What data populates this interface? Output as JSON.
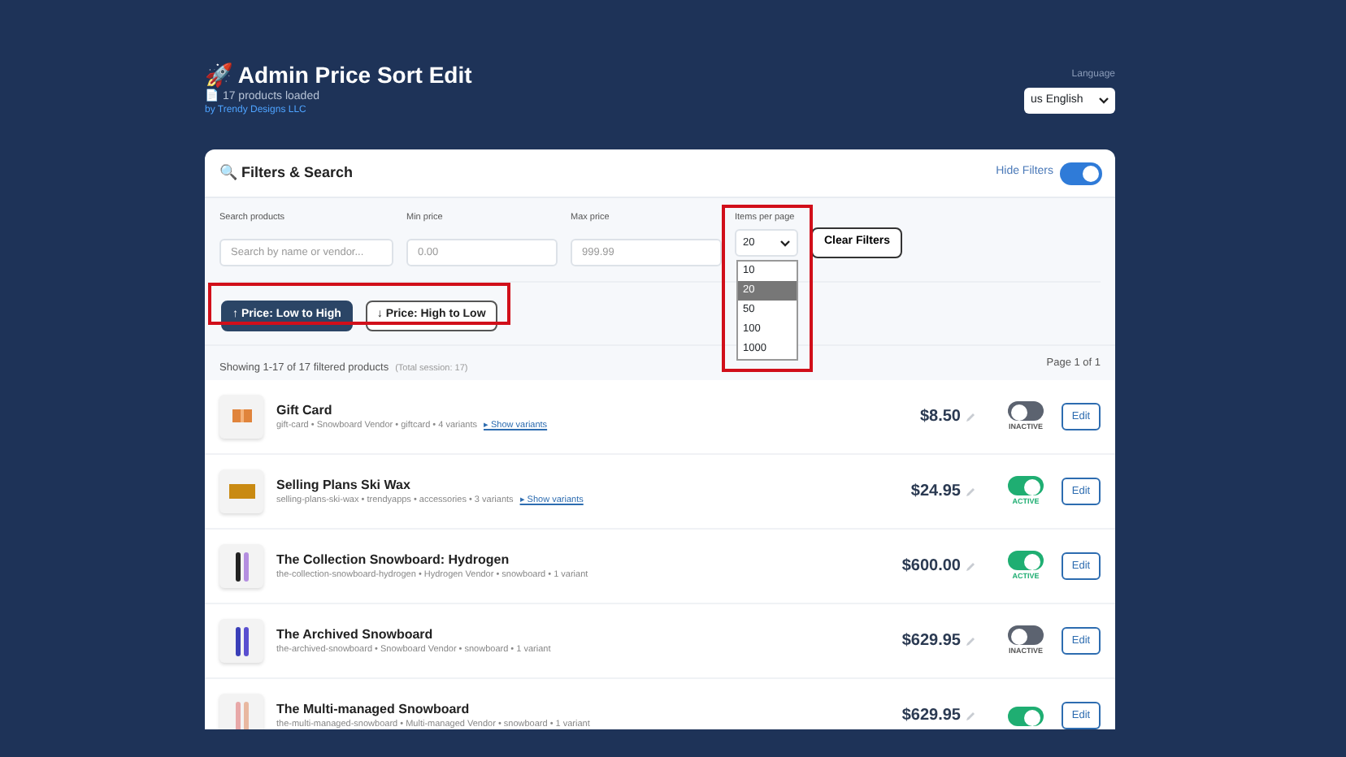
{
  "header": {
    "title": "🚀 Admin Price Sort Edit",
    "subtitle": "📄 17 products loaded",
    "byline": "by Trendy Designs LLC",
    "language_label": "Language",
    "language_value": "us English"
  },
  "filters": {
    "title": "🔍 Filters & Search",
    "hide_label": "Hide Filters",
    "hide_on": true,
    "fields": [
      {
        "label": "Search products",
        "placeholder": "Search by name or vendor..."
      },
      {
        "label": "Min price",
        "placeholder": "0.00"
      },
      {
        "label": "Max price",
        "placeholder": "999.99"
      }
    ],
    "per_page": {
      "label": "Items per page",
      "value": "20",
      "expanded": true,
      "options": [
        {
          "label": "10",
          "selected": false
        },
        {
          "label": "20",
          "selected": true
        },
        {
          "label": "50",
          "selected": false
        },
        {
          "label": "100",
          "selected": false
        },
        {
          "label": "1000",
          "selected": false
        }
      ]
    },
    "clear_button": "Clear Filters",
    "sort_buttons": [
      {
        "label": "↑ Price: Low to High",
        "selected": true
      },
      {
        "label": "↓ Price: High to Low",
        "selected": false
      }
    ]
  },
  "summary": {
    "showing": "Showing 1-17 of 17 filtered products",
    "note": "(Total session: 17)",
    "page": "Page 1 of 1"
  },
  "products": [
    {
      "title": "Gift Card",
      "meta": "gift-card • Snowboard Vendor • giftcard • 4 variants",
      "variants_link": "▸ Show variants",
      "price": "$8.50",
      "active": false,
      "status": "INACTIVE",
      "kind": "giftcard",
      "edit": "Edit"
    },
    {
      "title": "Selling Plans Ski Wax",
      "meta": "selling-plans-ski-wax • trendyapps • accessories • 3 variants",
      "variants_link": "▸ Show variants",
      "price": "$24.95",
      "active": true,
      "status": "ACTIVE",
      "kind": "wax",
      "edit": "Edit"
    },
    {
      "title": "The Collection Snowboard: Hydrogen",
      "meta": "the-collection-snowboard-hydrogen • Hydrogen Vendor • snowboard • 1 variant",
      "price": "$600.00",
      "active": true,
      "status": "ACTIVE",
      "kind": "board-dark",
      "edit": "Edit"
    },
    {
      "title": "The Archived Snowboard",
      "meta": "the-archived-snowboard • Snowboard Vendor • snowboard • 1 variant",
      "price": "$629.95",
      "active": false,
      "status": "INACTIVE",
      "kind": "board-blue",
      "edit": "Edit"
    },
    {
      "title": "The Multi-managed Snowboard",
      "meta": "the-multi-managed-snowboard • Multi-managed Vendor • snowboard • 1 variant",
      "price": "$629.95",
      "active": true,
      "kind": "board-pink",
      "edit": "Edit"
    }
  ]
}
